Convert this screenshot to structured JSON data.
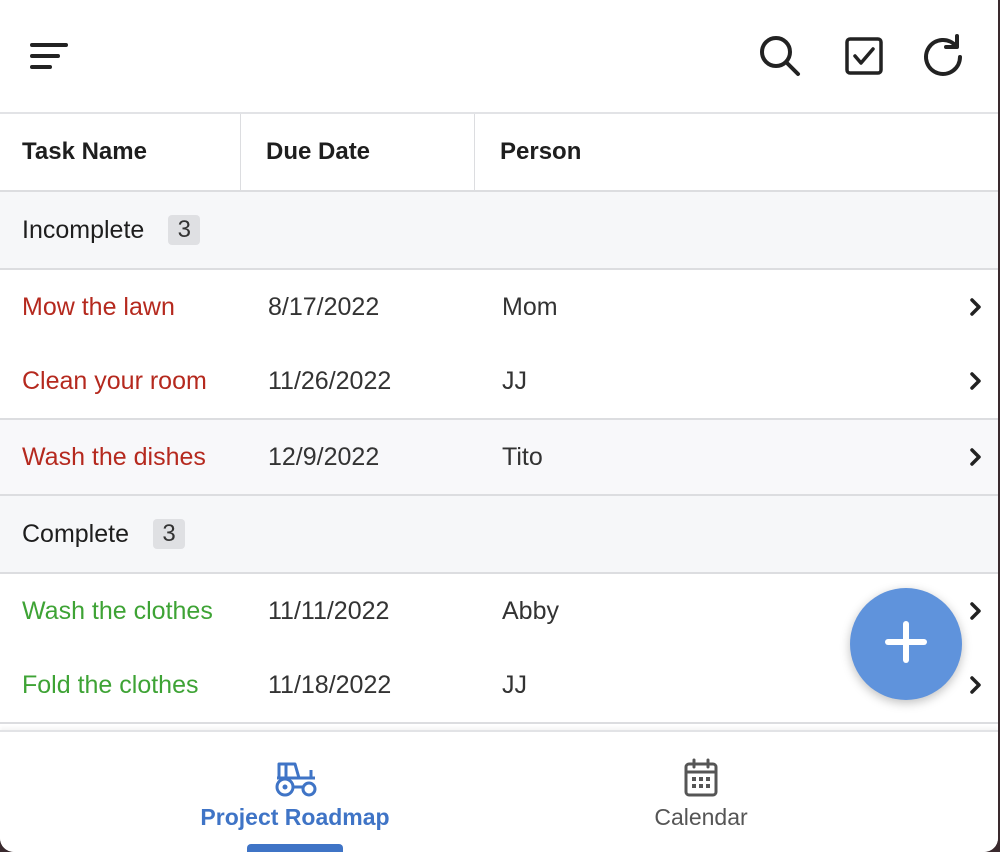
{
  "toolbar": {
    "menu_icon": "menu-icon",
    "search_icon": "search-icon",
    "check_icon": "checkbox-icon",
    "refresh_icon": "refresh-icon"
  },
  "table": {
    "columns": [
      "Task Name",
      "Due Date",
      "Person"
    ],
    "groups": [
      {
        "label": "Incomplete",
        "count": "3",
        "rows": [
          {
            "task": "Mow the lawn",
            "due": "8/17/2022",
            "person": "Mom"
          },
          {
            "task": "Clean your room",
            "due": "11/26/2022",
            "person": "JJ"
          },
          {
            "task": "Wash the dishes",
            "due": "12/9/2022",
            "person": "Tito"
          }
        ]
      },
      {
        "label": "Complete",
        "count": "3",
        "rows": [
          {
            "task": "Wash the clothes",
            "due": "11/11/2022",
            "person": "Abby"
          },
          {
            "task": "Fold the clothes",
            "due": "11/18/2022",
            "person": "JJ"
          }
        ]
      }
    ]
  },
  "colors": {
    "incomplete": "#b5291e",
    "complete": "#3ea335",
    "accent": "#3f74c6",
    "fab": "#5f93dc"
  },
  "fab": {
    "icon": "plus-icon"
  },
  "bottom_nav": {
    "items": [
      {
        "label": "Project Roadmap",
        "icon": "tractor-icon",
        "active": true
      },
      {
        "label": "Calendar",
        "icon": "calendar-icon",
        "active": false
      }
    ]
  }
}
